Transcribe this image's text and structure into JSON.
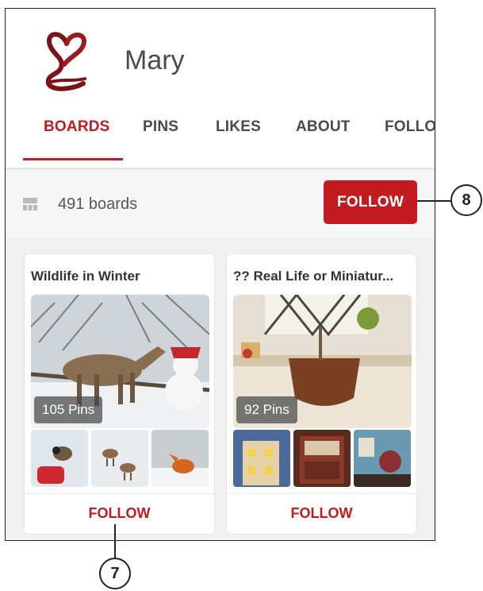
{
  "profile": {
    "name": "Mary"
  },
  "tabs": [
    {
      "label": "BOARDS",
      "active": true
    },
    {
      "label": "PINS",
      "active": false
    },
    {
      "label": "LIKES",
      "active": false
    },
    {
      "label": "ABOUT",
      "active": false
    },
    {
      "label": "FOLLOW",
      "active": false
    }
  ],
  "boards_bar": {
    "count_label": "491 boards",
    "follow_label": "FOLLOW"
  },
  "boards": [
    {
      "title": "Wildlife in Winter",
      "pins_label": "105 Pins",
      "follow_label": "FOLLOW"
    },
    {
      "title": "?? Real Life or Miniatur...",
      "pins_label": "92 Pins",
      "follow_label": "FOLLOW"
    }
  ],
  "callouts": [
    {
      "number": "8"
    },
    {
      "number": "7"
    }
  ],
  "colors": {
    "accent": "#c41b21",
    "background": "#f1f1f1",
    "text": "#4a4a4a"
  },
  "icons": [
    "heart-logo-icon",
    "board-grid-icon"
  ]
}
